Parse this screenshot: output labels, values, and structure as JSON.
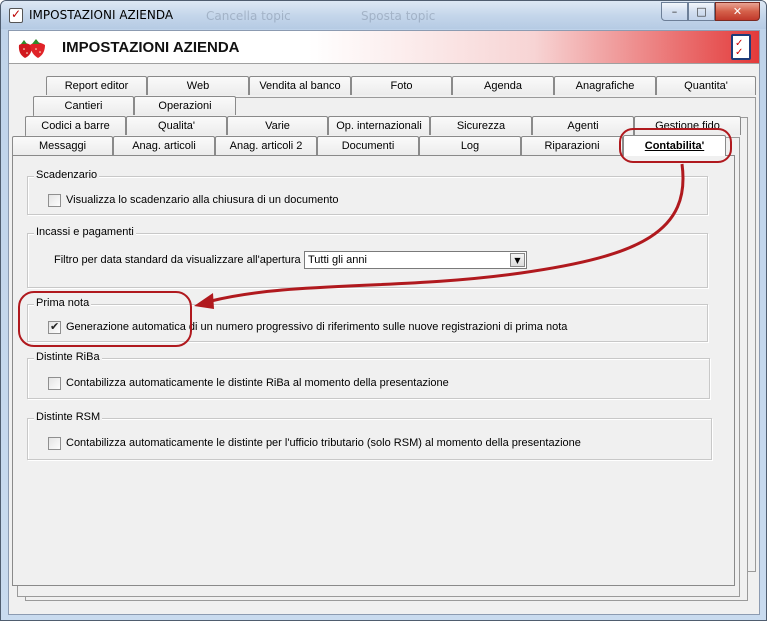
{
  "window": {
    "title": "IMPOSTAZIONI AZIENDA",
    "background_ghost_items": [
      "Cancella topic",
      "Sposta topic"
    ],
    "controls": {
      "minimize": "–",
      "maximize": "□",
      "close": "✕"
    }
  },
  "header": {
    "title": "IMPOSTAZIONI AZIENDA",
    "gradient_colors": [
      "#ffffff",
      "#e33a3a"
    ]
  },
  "tabs": {
    "row1": [
      "Report editor",
      "Web",
      "Vendita al banco",
      "Foto",
      "Agenda",
      "Anagrafiche",
      "Quantita'"
    ],
    "row2": [
      "Cantieri",
      "Operazioni"
    ],
    "row3": [
      "Codici a barre",
      "Qualita'",
      "Varie",
      "Op. internazionali",
      "Sicurezza",
      "Agenti",
      "Gestione fido"
    ],
    "row4": [
      "Messaggi",
      "Anag. articoli",
      "Anag. articoli 2",
      "Documenti",
      "Log",
      "Riparazioni",
      "Contabilita'"
    ],
    "active": "Contabilita'"
  },
  "groups": {
    "scadenzario": {
      "legend": "Scadenzario",
      "option": "Visualizza lo scadenzario alla chiusura di un documento",
      "checked": false
    },
    "incassi": {
      "legend": "Incassi e pagamenti",
      "filter_label": "Filtro per data standard da visualizzare all'apertura :",
      "filter_value": "Tutti gli anni"
    },
    "prima_nota": {
      "legend": "Prima nota",
      "option": "Generazione automatica di un numero progressivo di riferimento sulle nuove registrazioni di prima nota",
      "checked": true
    },
    "riba": {
      "legend": "Distinte RiBa",
      "option": "Contabilizza automaticamente le distinte RiBa al momento della presentazione",
      "checked": false
    },
    "rsm": {
      "legend": "Distinte RSM",
      "option": "Contabilizza automaticamente le distinte per l'ufficio tributario (solo RSM) al momento della presentazione",
      "checked": false
    }
  },
  "icons": {
    "app": "checklist-icon",
    "logo": "strawberry-icon",
    "dropdown": "chevron-down-icon"
  },
  "annotation_color": "#b0191e"
}
